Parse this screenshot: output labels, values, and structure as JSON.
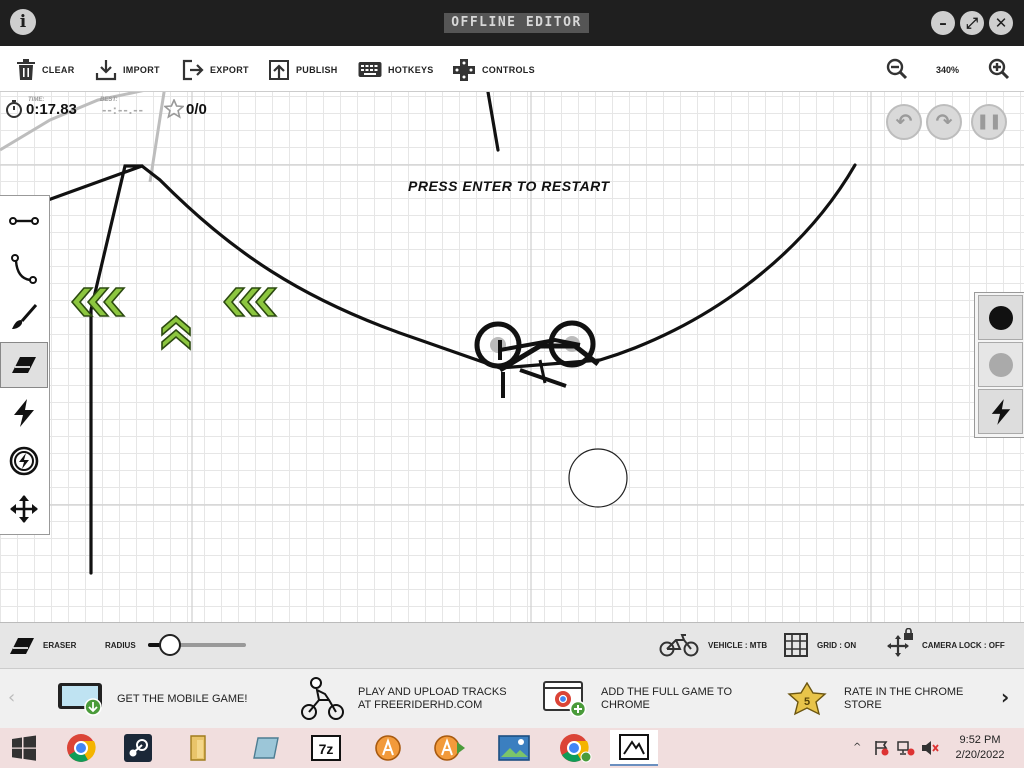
{
  "window": {
    "title": "OFFLINE EDITOR",
    "info_icon": "info-icon",
    "controls": [
      "minimize-icon",
      "maximize-icon",
      "close-icon"
    ]
  },
  "toolbar": {
    "items": [
      {
        "label": "CLEAR",
        "icon": "trash-icon"
      },
      {
        "label": "IMPORT",
        "icon": "import-icon"
      },
      {
        "label": "EXPORT",
        "icon": "export-icon"
      },
      {
        "label": "PUBLISH",
        "icon": "publish-icon"
      },
      {
        "label": "HOTKEYS",
        "icon": "keyboard-icon"
      },
      {
        "label": "CONTROLS",
        "icon": "gamepad-icon"
      }
    ],
    "zoom_level": "340%"
  },
  "hud": {
    "time_label": "TIME:",
    "time": "0:17.83",
    "best_label": "BEST:",
    "best": "--:--.--",
    "stars": "0/0",
    "message": "PRESS ENTER TO RESTART"
  },
  "playback": [
    "undo-icon",
    "redo-icon",
    "pause-icon"
  ],
  "tools": [
    "straight-line-icon",
    "curve-icon",
    "brush-icon",
    "eraser-icon",
    "boost-icon",
    "gravity-icon",
    "move-icon"
  ],
  "active_tool": "eraser",
  "line_colors": {
    "black": "#111111",
    "gray": "#aaaaaa",
    "scenery_icon": "lightning-icon"
  },
  "options": {
    "tool_name": "ERASER",
    "radius_label": "RADIUS",
    "radius_value_fraction": 0.22,
    "vehicle": "VEHICLE : MTB",
    "grid": "GRID : ON",
    "camera_lock": "CAMERA LOCK : OFF"
  },
  "promos": [
    {
      "text": "GET THE MOBILE GAME!"
    },
    {
      "text": "PLAY AND UPLOAD TRACKS AT FREERIDERHD.COM"
    },
    {
      "text": "ADD THE FULL GAME TO CHROME"
    },
    {
      "text": "RATE IN THE CHROME STORE"
    }
  ],
  "taskbar": {
    "time": "9:52 PM",
    "date": "2/20/2022"
  },
  "colors": {
    "boost_green": "#8cc63f",
    "titlebar": "#1f1f1f",
    "taskbar": "#f1dede"
  }
}
